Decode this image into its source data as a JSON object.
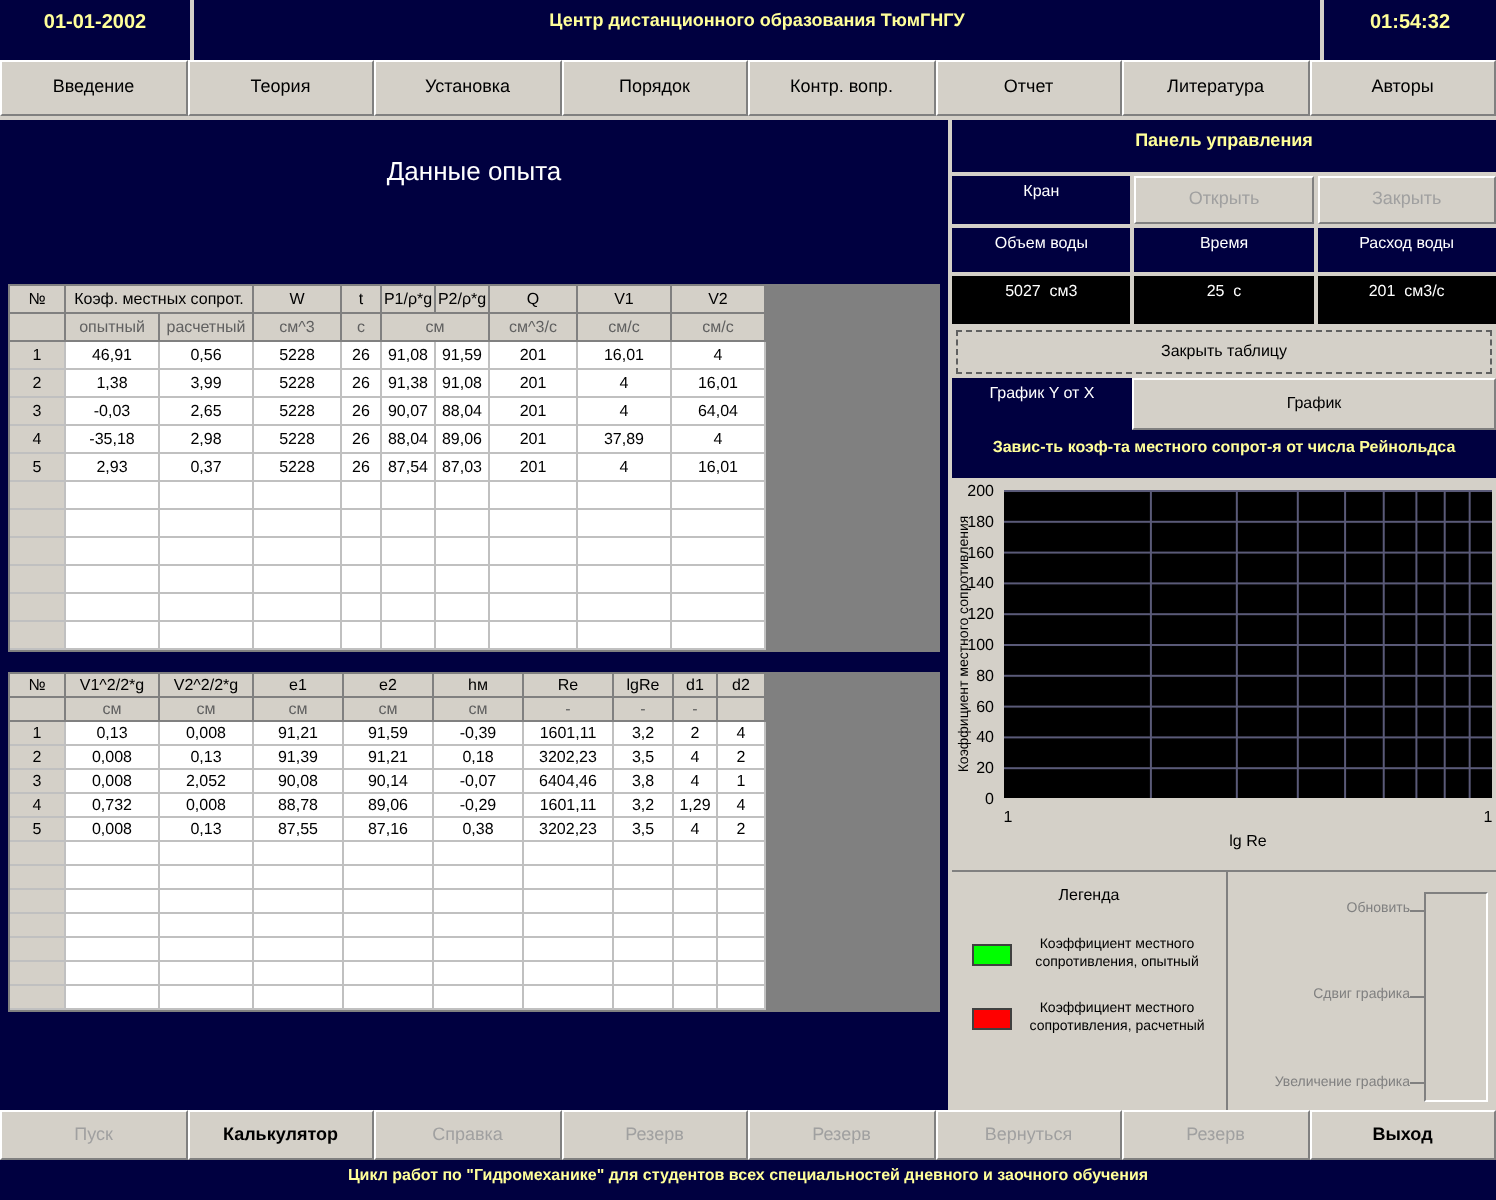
{
  "top_bar": {
    "date": "01-01-2002",
    "title": "Центр дистанционного образования ТюмГНГУ",
    "time": "01:54:32"
  },
  "menu": [
    {
      "label": "Введение",
      "disabled": false
    },
    {
      "label": "Теория",
      "disabled": false
    },
    {
      "label": "Установка",
      "disabled": false
    },
    {
      "label": "Порядок",
      "disabled": false
    },
    {
      "label": "Контр. вопр.",
      "disabled": false
    },
    {
      "label": "Отчет",
      "disabled": false
    },
    {
      "label": "Литература",
      "disabled": false
    },
    {
      "label": "Авторы",
      "disabled": false
    }
  ],
  "data_title": "Данные опыта",
  "table1": {
    "header": [
      {
        "label": "№"
      },
      {
        "label": "Коэф. местных сопрот."
      },
      {
        "label": "W"
      },
      {
        "label": "t"
      },
      {
        "label": "P1/ρ*g"
      },
      {
        "label": "P2/ρ*g"
      },
      {
        "label": "Q"
      },
      {
        "label": "V1"
      },
      {
        "label": "V2"
      }
    ],
    "units": [
      "опытный",
      "расчетный",
      "см^3",
      "с",
      "см",
      "см^3/с",
      "см/с",
      "см/с"
    ],
    "rows": [
      [
        "1",
        "46,91",
        "0,56",
        "5228",
        "26",
        "91,08",
        "91,59",
        "201",
        "16,01",
        "4"
      ],
      [
        "2",
        "1,38",
        "3,99",
        "5228",
        "26",
        "91,38",
        "91,08",
        "201",
        "4",
        "16,01"
      ],
      [
        "3",
        "-0,03",
        "2,65",
        "5228",
        "26",
        "90,07",
        "88,04",
        "201",
        "4",
        "64,04"
      ],
      [
        "4",
        "-35,18",
        "2,98",
        "5228",
        "26",
        "88,04",
        "89,06",
        "201",
        "37,89",
        "4"
      ],
      [
        "5",
        "2,93",
        "0,37",
        "5228",
        "26",
        "87,54",
        "87,03",
        "201",
        "4",
        "16,01"
      ]
    ]
  },
  "table2": {
    "header": [
      {
        "label": "№"
      },
      {
        "label": "V1^2/2*g"
      },
      {
        "label": "V2^2/2*g"
      },
      {
        "label": "e1"
      },
      {
        "label": "e2"
      },
      {
        "label": "hм"
      },
      {
        "label": "Re"
      },
      {
        "label": "lgRe"
      },
      {
        "label": "d1"
      },
      {
        "label": "d2"
      }
    ],
    "units": [
      "см",
      "см",
      "см",
      "см",
      "см",
      "-",
      "-",
      "-"
    ],
    "rows": [
      [
        "1",
        "0,13",
        "0,008",
        "91,21",
        "91,59",
        "-0,39",
        "1601,11",
        "3,2",
        "2",
        "4"
      ],
      [
        "2",
        "0,008",
        "0,13",
        "91,39",
        "91,21",
        "0,18",
        "3202,23",
        "3,5",
        "4",
        "2"
      ],
      [
        "3",
        "0,008",
        "2,052",
        "90,08",
        "90,14",
        "-0,07",
        "6404,46",
        "3,8",
        "4",
        "1"
      ],
      [
        "4",
        "0,732",
        "0,008",
        "88,78",
        "89,06",
        "-0,29",
        "1601,11",
        "3,2",
        "1,29",
        "4"
      ],
      [
        "5",
        "0,008",
        "0,13",
        "87,55",
        "87,16",
        "0,38",
        "3202,23",
        "3,5",
        "4",
        "2"
      ]
    ]
  },
  "control_panel": {
    "title": "Панель управления",
    "valve_label": "Кран",
    "valve_buttons": [
      {
        "label": "Открыть",
        "disabled": true
      },
      {
        "label": "Закрыть",
        "disabled": true
      }
    ],
    "readings": [
      {
        "label": "Объем воды",
        "value": "5027  см3"
      },
      {
        "label": "Время",
        "value": "25  с"
      },
      {
        "label": "Расход воды",
        "value": "201  см3/с"
      }
    ],
    "close_table_button": "Закрыть таблицу",
    "graph_label": "График Y от X",
    "graph_button": "График",
    "chart_title": "Завис-ть коэф-та местного сопрот-я от числа Рейнольдса",
    "chart_data": {
      "type": "line",
      "xlabel": "lg Re",
      "ylabel": "Коэффициент местного сопротивления",
      "ylim": [
        0,
        200
      ],
      "yticks": [
        0,
        20,
        40,
        60,
        80,
        100,
        120,
        140,
        160,
        180,
        200
      ],
      "categories": [
        "1",
        "1"
      ]
    },
    "legend": {
      "title": "Легенда",
      "items": [
        {
          "label": "Коэффициент местного сопротивления, опытный",
          "color": "#00ff00"
        },
        {
          "label": "Коэффициент местного сопротивления, расчетный",
          "color": "#ff0000"
        }
      ]
    },
    "slider_labels": [
      "Обновить",
      "Сдвиг графика",
      "Увеличение графика"
    ]
  },
  "bottom_buttons": [
    {
      "label": "Пуск",
      "disabled": true
    },
    {
      "label": "Калькулятор",
      "disabled": false
    },
    {
      "label": "Справка",
      "disabled": true
    },
    {
      "label": "Резерв",
      "disabled": true
    },
    {
      "label": "Резерв",
      "disabled": true
    },
    {
      "label": "Вернуться",
      "disabled": true
    },
    {
      "label": "Резерв",
      "disabled": true
    },
    {
      "label": "Выход",
      "disabled": false
    }
  ],
  "footer": "Цикл работ по \"Гидромеханике\" для студентов всех специальностей дневного и заочного обучения"
}
